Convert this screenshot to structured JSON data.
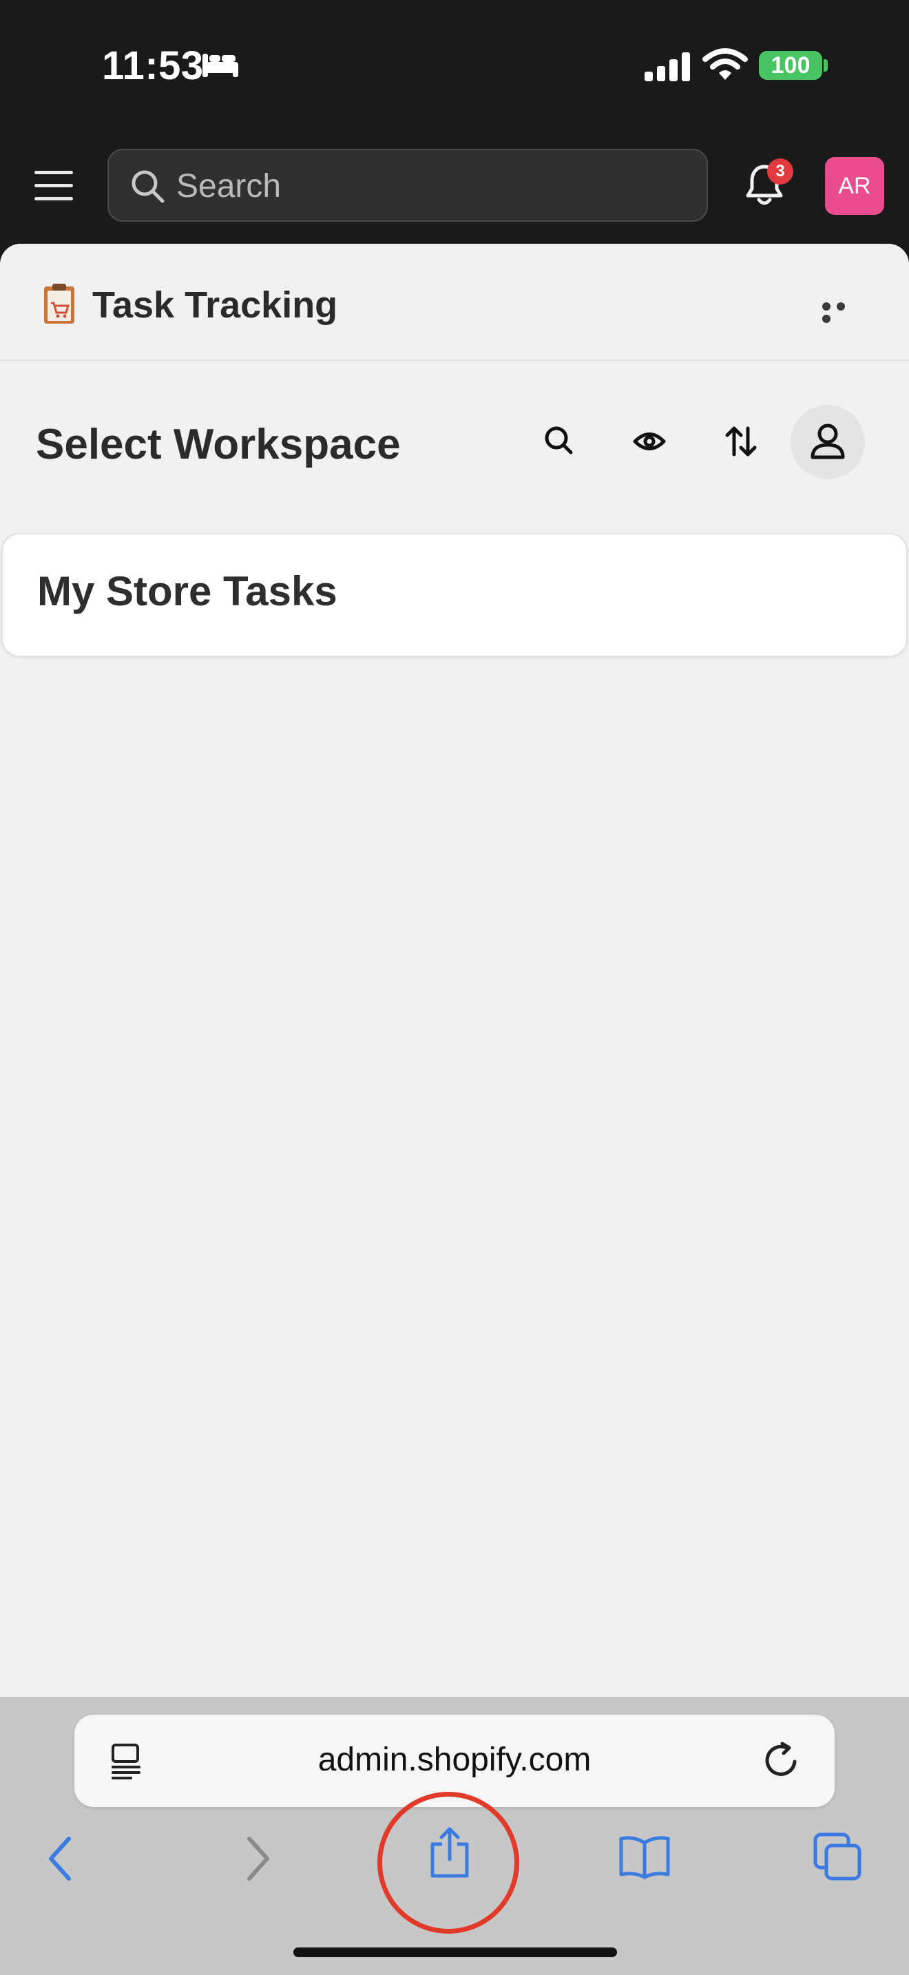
{
  "status_bar": {
    "time": "11:53",
    "battery": "100"
  },
  "top_nav": {
    "search_placeholder": "Search",
    "notification_count": "3",
    "avatar_initials": "AR"
  },
  "app": {
    "title": "Task Tracking"
  },
  "workspace": {
    "heading": "Select Workspace",
    "items": [
      {
        "label": "My Store Tasks"
      }
    ]
  },
  "browser": {
    "url": "admin.shopify.com"
  },
  "colors": {
    "accent_blue": "#3a7be0",
    "avatar_pink": "#e94d8e",
    "badge_red": "#e0393e",
    "highlight_red": "#e23a2a",
    "battery_green": "#49c463"
  }
}
